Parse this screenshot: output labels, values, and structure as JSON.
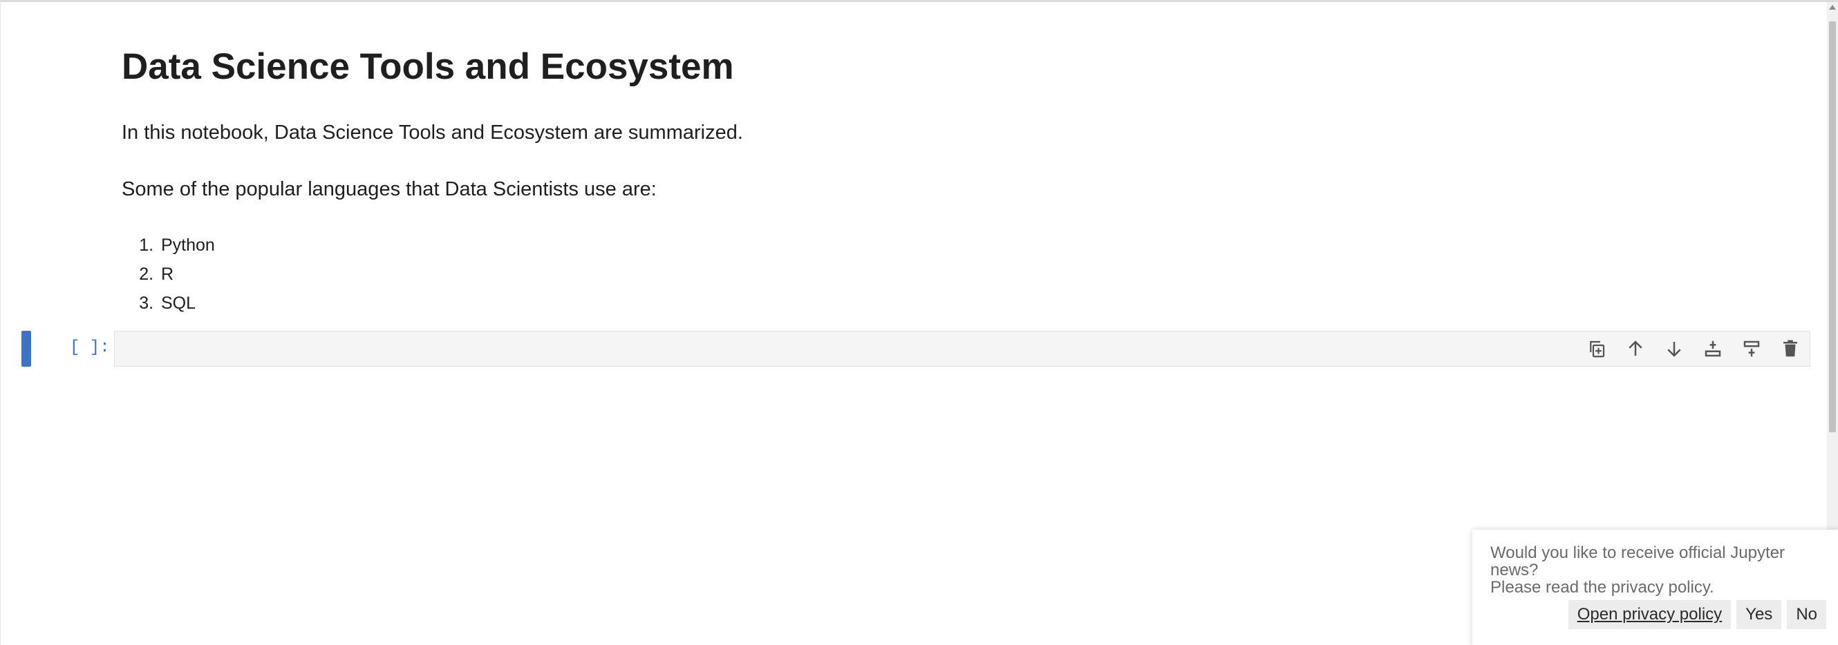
{
  "notebook": {
    "title": "Data Science Tools and Ecosystem",
    "intro": "In this notebook, Data Science Tools and Ecosystem are summarized.",
    "languages_heading": "Some of the popular languages that Data Scientists use are:",
    "languages": [
      "Python",
      "R",
      "SQL"
    ]
  },
  "code_cell": {
    "prompt": "[ ]:",
    "content": ""
  },
  "cell_toolbar": {
    "icons": [
      "duplicate-icon",
      "move-up-icon",
      "move-down-icon",
      "insert-above-icon",
      "insert-below-icon",
      "delete-icon"
    ]
  },
  "toast": {
    "line1": "Would you like to receive official Jupyter news?",
    "line2": "Please read the privacy policy.",
    "open_policy_label": "Open privacy policy",
    "yes_label": "Yes",
    "no_label": "No"
  },
  "colors": {
    "accent": "#3b74c7",
    "icon": "#555555"
  }
}
